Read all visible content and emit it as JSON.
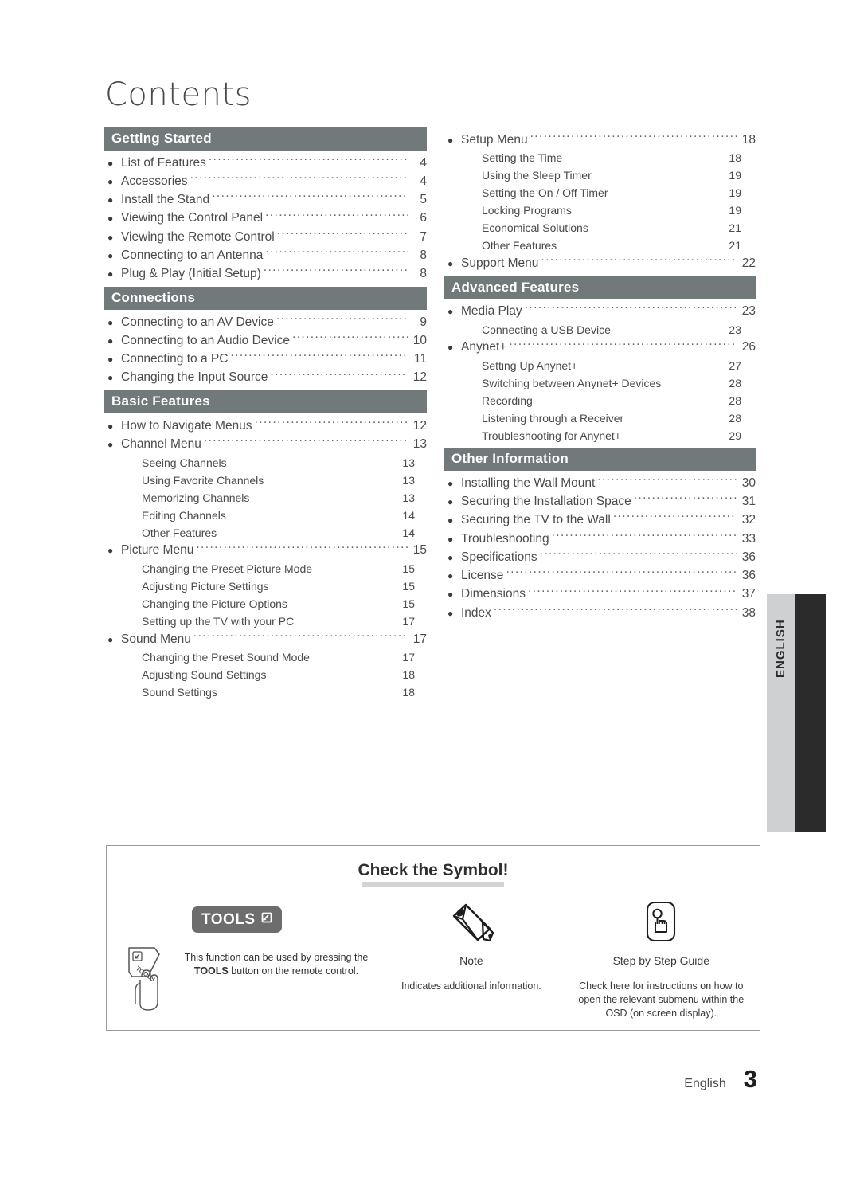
{
  "page_title": "Contents",
  "columns": {
    "left": [
      {
        "header": "Getting Started",
        "entries": [
          {
            "type": "main",
            "label": "List of Features",
            "page": "4"
          },
          {
            "type": "main",
            "label": "Accessories",
            "page": "4"
          },
          {
            "type": "main",
            "label": "Install the Stand",
            "page": "5"
          },
          {
            "type": "main",
            "label": "Viewing the Control Panel",
            "page": "6"
          },
          {
            "type": "main",
            "label": "Viewing the Remote Control",
            "page": "7"
          },
          {
            "type": "main",
            "label": "Connecting to an Antenna",
            "page": "8"
          },
          {
            "type": "main",
            "label": "Plug & Play (Initial Setup)",
            "page": "8"
          }
        ]
      },
      {
        "header": "Connections",
        "entries": [
          {
            "type": "main",
            "label": "Connecting to an AV Device",
            "page": "9"
          },
          {
            "type": "main",
            "label": "Connecting to an Audio Device",
            "page": "10"
          },
          {
            "type": "main",
            "label": "Connecting to a PC",
            "page": "11"
          },
          {
            "type": "main",
            "label": "Changing the Input Source",
            "page": "12"
          }
        ]
      },
      {
        "header": "Basic Features",
        "entries": [
          {
            "type": "main",
            "label": "How to Navigate Menus",
            "page": "12"
          },
          {
            "type": "main",
            "label": "Channel Menu",
            "page": "13"
          },
          {
            "type": "sub",
            "label": "Seeing Channels",
            "page": "13"
          },
          {
            "type": "sub",
            "label": "Using Favorite Channels",
            "page": "13"
          },
          {
            "type": "sub",
            "label": "Memorizing Channels",
            "page": "13"
          },
          {
            "type": "sub",
            "label": "Editing Channels",
            "page": "14"
          },
          {
            "type": "sub",
            "label": "Other Features",
            "page": "14"
          },
          {
            "type": "main",
            "label": "Picture Menu",
            "page": "15"
          },
          {
            "type": "sub",
            "label": "Changing the Preset Picture Mode",
            "page": "15"
          },
          {
            "type": "sub",
            "label": "Adjusting Picture Settings",
            "page": "15"
          },
          {
            "type": "sub",
            "label": "Changing the Picture Options",
            "page": "15"
          },
          {
            "type": "sub",
            "label": "Setting up the TV with your PC",
            "page": "17"
          },
          {
            "type": "main",
            "label": "Sound Menu",
            "page": "17"
          },
          {
            "type": "sub",
            "label": "Changing the Preset Sound Mode",
            "page": "17"
          },
          {
            "type": "sub",
            "label": "Adjusting Sound Settings",
            "page": "18"
          },
          {
            "type": "sub",
            "label": "Sound Settings",
            "page": "18"
          }
        ]
      }
    ],
    "right": [
      {
        "header": null,
        "entries": [
          {
            "type": "main",
            "label": "Setup Menu",
            "page": "18"
          },
          {
            "type": "sub",
            "label": "Setting the Time",
            "page": "18"
          },
          {
            "type": "sub",
            "label": "Using the Sleep Timer",
            "page": "19"
          },
          {
            "type": "sub",
            "label": "Setting the On / Off Timer",
            "page": "19"
          },
          {
            "type": "sub",
            "label": "Locking Programs",
            "page": "19"
          },
          {
            "type": "sub",
            "label": "Economical Solutions",
            "page": "21"
          },
          {
            "type": "sub",
            "label": "Other Features",
            "page": "21"
          },
          {
            "type": "main",
            "label": "Support Menu",
            "page": "22"
          }
        ]
      },
      {
        "header": "Advanced Features",
        "entries": [
          {
            "type": "main",
            "label": "Media Play",
            "page": "23"
          },
          {
            "type": "sub",
            "label": "Connecting a USB Device",
            "page": "23"
          },
          {
            "type": "main",
            "label": "Anynet+",
            "page": "26"
          },
          {
            "type": "sub",
            "label": "Setting Up Anynet+",
            "page": "27"
          },
          {
            "type": "sub",
            "label": "Switching between Anynet+ Devices",
            "page": "28"
          },
          {
            "type": "sub",
            "label": "Recording",
            "page": "28"
          },
          {
            "type": "sub",
            "label": "Listening through a Receiver",
            "page": "28"
          },
          {
            "type": "sub",
            "label": "Troubleshooting for Anynet+",
            "page": "29"
          }
        ]
      },
      {
        "header": "Other Information",
        "entries": [
          {
            "type": "main",
            "label": "Installing the Wall Mount",
            "page": "30"
          },
          {
            "type": "main",
            "label": "Securing the Installation Space",
            "page": "31"
          },
          {
            "type": "main",
            "label": "Securing the TV to the Wall",
            "page": "32"
          },
          {
            "type": "main",
            "label": "Troubleshooting",
            "page": "33"
          },
          {
            "type": "main",
            "label": "Specifications",
            "page": "36"
          },
          {
            "type": "main",
            "label": "License",
            "page": "36"
          },
          {
            "type": "main",
            "label": "Dimensions",
            "page": "37"
          },
          {
            "type": "main",
            "label": "Index",
            "page": "38"
          }
        ]
      }
    ]
  },
  "side_tab": {
    "label": "ENGLISH"
  },
  "symbol_box": {
    "title": "Check the Symbol!",
    "items": [
      {
        "badge_label": "TOOLS",
        "icon_name": "tools-badge-icon",
        "text_line1": "This function can be used by pressing the",
        "text_bold": "TOOLS",
        "text_line2": "button on the remote control."
      },
      {
        "icon_name": "pencil-icon",
        "caption": "Note",
        "description": "Indicates additional information."
      },
      {
        "icon_name": "hand-press-icon",
        "caption": "Step by Step Guide",
        "description": "Check here for instructions on how to open the relevant submenu within the OSD (on screen display)."
      }
    ]
  },
  "footer": {
    "language": "English",
    "page_number": "3"
  },
  "colors": {
    "section_header_bg": "#72797a",
    "tab_light": "#cfd0d1",
    "tab_dark": "#2b2b2b",
    "tools_badge_bg": "#6d6d6d",
    "title_underline": "#d4d4d4"
  }
}
